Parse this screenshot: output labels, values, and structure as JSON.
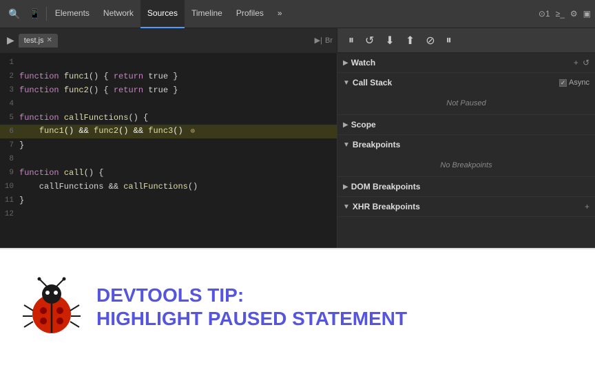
{
  "toolbar": {
    "tabs": [
      {
        "label": "Elements",
        "active": false
      },
      {
        "label": "Network",
        "active": false
      },
      {
        "label": "Sources",
        "active": true
      },
      {
        "label": "Timeline",
        "active": false
      },
      {
        "label": "Profiles",
        "active": false
      },
      {
        "label": "»",
        "active": false
      }
    ],
    "right": {
      "thread": "⊙1",
      "console_btn": "≥_",
      "settings_btn": "⚙",
      "display_btn": "▣"
    }
  },
  "debug_bar": {
    "file_tab": "test.js",
    "pause_btn": "⏸",
    "step_over": "↺",
    "step_into": "↓",
    "step_out": "↑",
    "deactivate": "⊘",
    "pause_on_exception": "⏸"
  },
  "code": {
    "lines": [
      {
        "num": 1,
        "content": ""
      },
      {
        "num": 2,
        "content": "function func1() { return true }"
      },
      {
        "num": 3,
        "content": "function func2() { return true }"
      },
      {
        "num": 4,
        "content": ""
      },
      {
        "num": 5,
        "content": "function callFunctions() {"
      },
      {
        "num": 6,
        "content": "    func1() && func2() && func3()",
        "highlight": true,
        "warning": true
      },
      {
        "num": 7,
        "content": "}"
      },
      {
        "num": 8,
        "content": ""
      },
      {
        "num": 9,
        "content": "function call() {"
      },
      {
        "num": 10,
        "content": "    callFunctions && callFunctions()"
      },
      {
        "num": 11,
        "content": "}"
      },
      {
        "num": 12,
        "content": ""
      }
    ]
  },
  "right_panel": {
    "sections": [
      {
        "id": "watch",
        "label": "Watch",
        "expanded": true,
        "arrow": "▶",
        "actions": [
          "+",
          "↺"
        ],
        "status": null
      },
      {
        "id": "call_stack",
        "label": "Call Stack",
        "expanded": true,
        "arrow": "▼",
        "async_label": "Async",
        "async_checked": true,
        "status": "Not Paused"
      },
      {
        "id": "scope",
        "label": "Scope",
        "expanded": false,
        "arrow": "▶",
        "status": null
      },
      {
        "id": "breakpoints",
        "label": "Breakpoints",
        "expanded": true,
        "arrow": "▼",
        "status": "No Breakpoints"
      },
      {
        "id": "dom_breakpoints",
        "label": "DOM Breakpoints",
        "expanded": false,
        "arrow": "▶",
        "status": null
      },
      {
        "id": "xhr_breakpoints",
        "label": "XHR Breakpoints",
        "expanded": false,
        "arrow": "▼",
        "status": null,
        "actions": [
          "+"
        ]
      }
    ]
  },
  "tip": {
    "title_line1": "DevTools Tip:",
    "title_line2": "Highlight Paused Statement"
  }
}
